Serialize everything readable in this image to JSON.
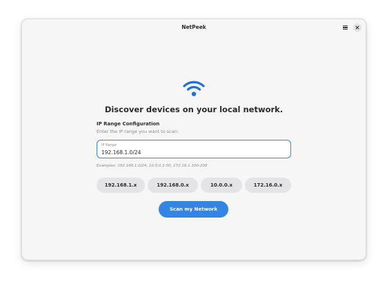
{
  "window": {
    "title": "NetPeek"
  },
  "header": {
    "menu_icon": "hamburger-menu-icon",
    "close_icon": "close-icon"
  },
  "main": {
    "hero_icon": "wifi-icon",
    "headline": "Discover devices on your local network.",
    "section_title": "IP Range Configuration",
    "section_subtitle": "Enter the IP range you want to scan:",
    "ip_input": {
      "label": "IP Range",
      "value": "192.168.1.0/24"
    },
    "examples": "Examples: 192.168.1.0/24, 10.0.0.1-50, 172.16.1.100-200",
    "presets": [
      {
        "label": "192.168.1.x"
      },
      {
        "label": "192.168.0.x"
      },
      {
        "label": "10.0.0.x"
      },
      {
        "label": "172.16.0.x"
      }
    ],
    "scan_button": "Scan my Network"
  },
  "colors": {
    "accent": "#3584e4",
    "window_bg": "#f6f6f7",
    "chip_bg": "#e4e4e6",
    "icon_blue": "#1c71d8"
  }
}
